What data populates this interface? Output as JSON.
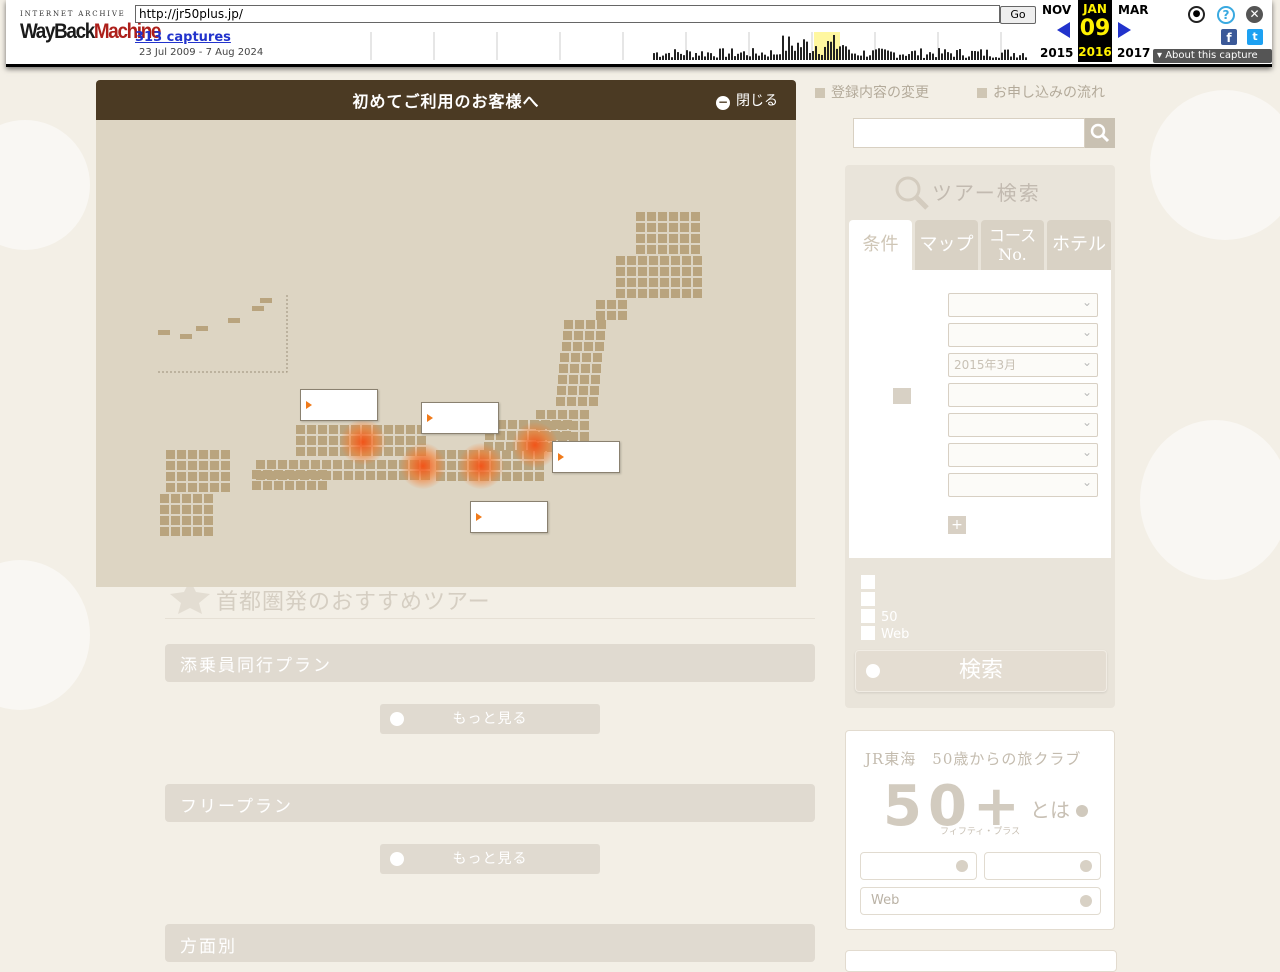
{
  "wayback": {
    "logo_top": "INTERNET ARCHIVE",
    "logo_way": "WayBack",
    "logo_machine": "Machine",
    "url": "http://jr50plus.jp/",
    "go_label": "Go",
    "captures": "313 captures",
    "range": "23 Jul 2009 - 7 Aug 2024",
    "prev_month": "NOV",
    "cur_month": "JAN",
    "next_month": "MAR",
    "prev_year": "2015",
    "cur_day": "09",
    "cur_year": "2016",
    "next_year": "2017",
    "about": "About this capture",
    "icons": [
      "user-icon",
      "help-icon",
      "close-icon",
      "facebook-icon",
      "twitter-icon"
    ]
  },
  "toplinks": {
    "edit": "登録内容の変更",
    "flow": "お申し込みの流れ"
  },
  "search": {
    "placeholder": "",
    "title": "ツアー検索",
    "tabs": [
      "条件",
      "マップ",
      "コース No.",
      "ホテル"
    ],
    "fields": [
      {
        "label": "",
        "value": ""
      },
      {
        "label": "",
        "value": ""
      },
      {
        "label": "",
        "value": "2015年3月"
      },
      {
        "label": "",
        "value": ""
      },
      {
        "label": "",
        "value": ""
      },
      {
        "label": "",
        "value": ""
      },
      {
        "label": "",
        "value": ""
      }
    ],
    "more_conditions": "",
    "checks": [
      "",
      "",
      "50",
      "Web"
    ],
    "submit": "検索"
  },
  "club": {
    "title": "JR東海　50歳からの旅クラブ",
    "big": "50+",
    "toha": "とは",
    "small": "フィフティ・プラス",
    "buttons": [
      "",
      "",
      "Web"
    ]
  },
  "main": {
    "section_title": "首都圏発のおすすめツアー",
    "nav": [
      "",
      "",
      "",
      ""
    ],
    "bars": [
      "添乗員同行プラン",
      "フリープラン",
      "方面別"
    ],
    "more": "もっと見る"
  },
  "overlay": {
    "title": "初めてご利用のお客様へ",
    "close": "閉じる",
    "text1": "",
    "text2": "",
    "text3a": "",
    "text3b": "",
    "labels": [
      "",
      "",
      "",
      ""
    ]
  },
  "colors": {
    "overlay_header": "#4b3a23",
    "map_land": "#b9a47e",
    "accent_orange": "#e2381b",
    "wayback_blue": "#2233cc",
    "wayback_highlight": "#fff200"
  }
}
